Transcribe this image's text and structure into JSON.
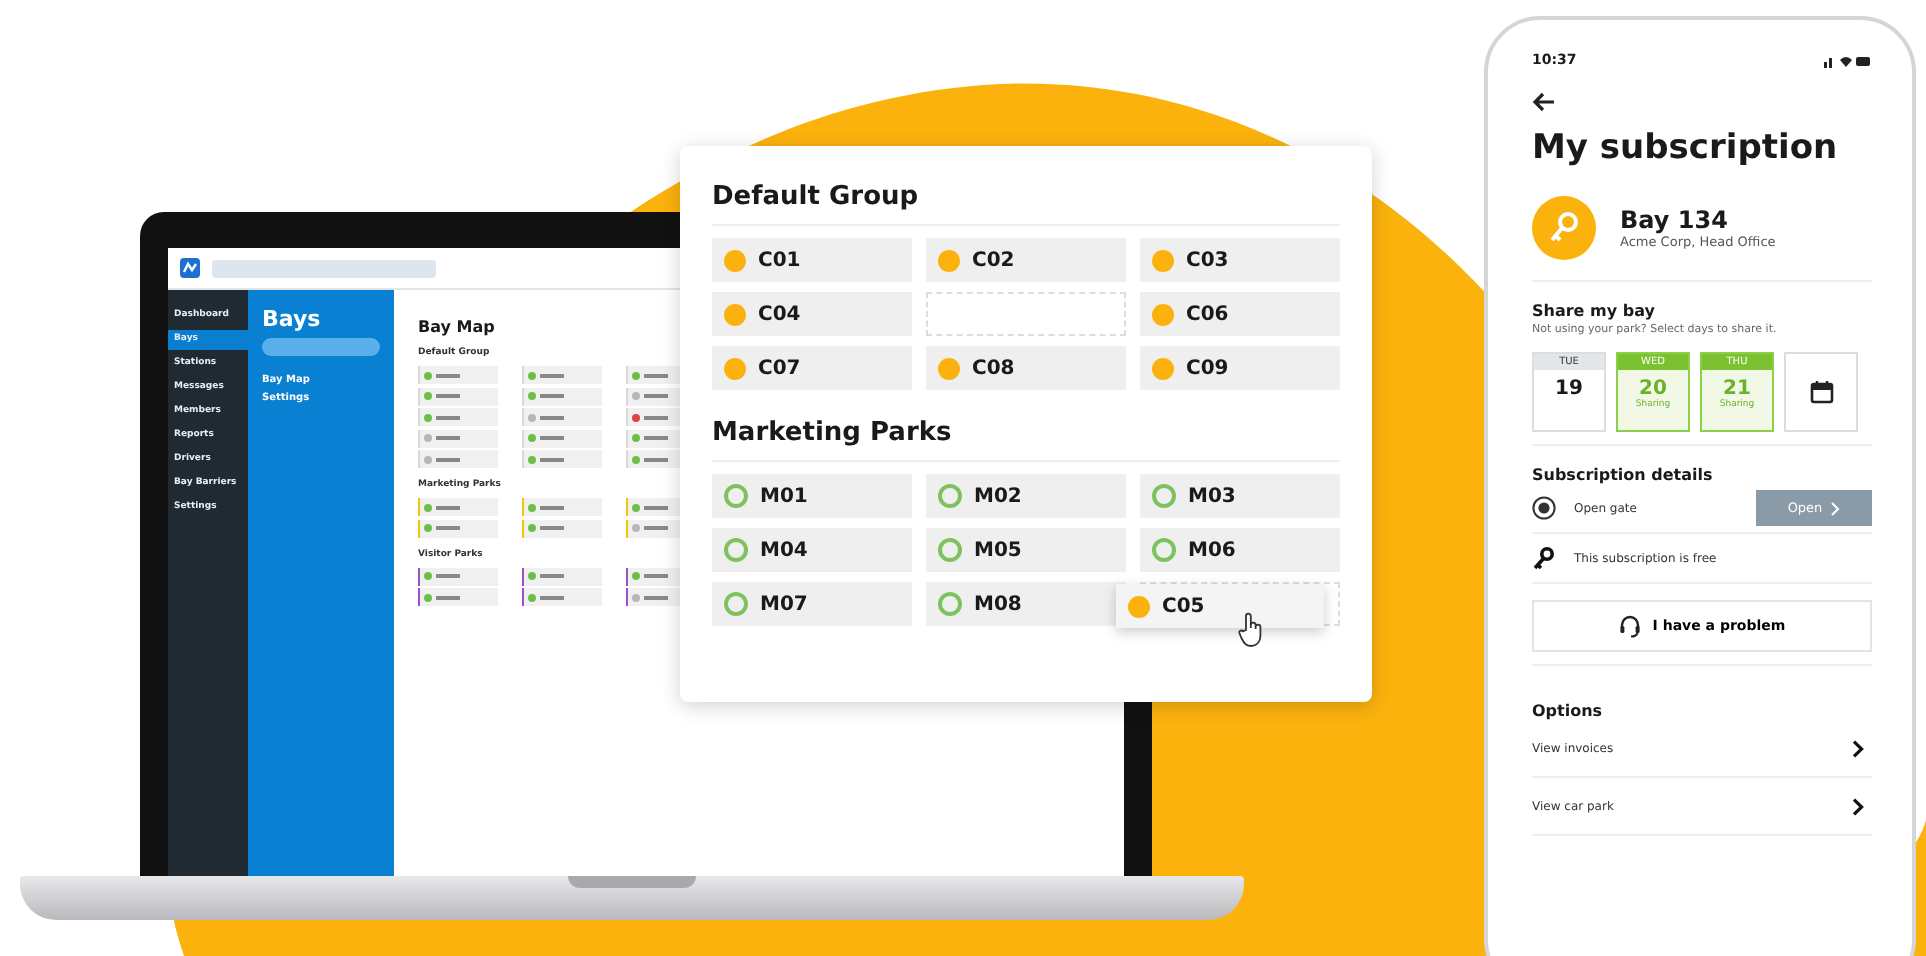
{
  "laptop": {
    "nav": [
      {
        "label": "Dashboard",
        "selected": false
      },
      {
        "label": "Bays",
        "selected": true
      },
      {
        "label": "Stations",
        "selected": false
      },
      {
        "label": "Messages",
        "selected": false
      },
      {
        "label": "Members",
        "selected": false
      },
      {
        "label": "Reports",
        "selected": false
      },
      {
        "label": "Drivers",
        "selected": false
      },
      {
        "label": "Bay Barriers",
        "selected": false
      },
      {
        "label": "Settings",
        "selected": false
      }
    ],
    "panel": {
      "title": "Bays",
      "links": [
        "Bay Map",
        "Settings"
      ]
    },
    "content": {
      "title": "Bay Map",
      "groups": [
        {
          "name": "Default Group",
          "color": "#d8d8d8",
          "bays": [
            {
              "color": "#6cc04a"
            },
            {
              "color": "#6cc04a"
            },
            {
              "color": "#6cc04a"
            },
            {
              "color": "#6cc04a"
            },
            {
              "color": "#6cc04a"
            },
            {
              "color": "#b8b8b8"
            },
            {
              "color": "#6cc04a"
            },
            {
              "color": "#b8b8b8"
            },
            {
              "color": "#e0404a"
            },
            {
              "color": "#b8b8b8"
            },
            {
              "color": "#6cc04a"
            },
            {
              "color": "#6cc04a"
            },
            {
              "color": "#b8b8b8"
            },
            {
              "color": "#6cc04a"
            },
            {
              "color": "#6cc04a"
            }
          ]
        },
        {
          "name": "Marketing Parks",
          "color": "#f5c400",
          "bays": [
            {
              "color": "#6cc04a"
            },
            {
              "color": "#6cc04a"
            },
            {
              "color": "#6cc04a"
            },
            {
              "color": "#6cc04a"
            },
            {
              "color": "#6cc04a"
            },
            {
              "color": "#b8b8b8"
            }
          ]
        },
        {
          "name": "Visitor Parks",
          "color": "#a050c8",
          "bays": [
            {
              "color": "#6cc04a"
            },
            {
              "color": "#6cc04a"
            },
            {
              "color": "#6cc04a"
            },
            {
              "color": "#6cc04a"
            },
            {
              "color": "#6cc04a"
            },
            {
              "color": "#b8b8b8"
            }
          ]
        }
      ]
    }
  },
  "popup": {
    "groups": [
      {
        "title": "Default Group",
        "bays": [
          {
            "label": "C01",
            "kind": "assigned"
          },
          {
            "label": "C02",
            "kind": "assigned"
          },
          {
            "label": "C03",
            "kind": "assigned"
          },
          {
            "label": "C04",
            "kind": "assigned"
          },
          {
            "kind": "empty"
          },
          {
            "label": "C06",
            "kind": "assigned"
          },
          {
            "label": "C07",
            "kind": "assigned"
          },
          {
            "label": "C08",
            "kind": "assigned"
          },
          {
            "label": "C09",
            "kind": "assigned"
          }
        ]
      },
      {
        "title": "Marketing Parks",
        "bays": [
          {
            "label": "M01",
            "kind": "available"
          },
          {
            "label": "M02",
            "kind": "available"
          },
          {
            "label": "M03",
            "kind": "available"
          },
          {
            "label": "M04",
            "kind": "available"
          },
          {
            "label": "M05",
            "kind": "available"
          },
          {
            "label": "M06",
            "kind": "available"
          },
          {
            "label": "M07",
            "kind": "available"
          },
          {
            "label": "M08",
            "kind": "available"
          },
          {
            "kind": "empty"
          }
        ]
      }
    ],
    "dragged": {
      "label": "C05",
      "kind": "assigned"
    }
  },
  "phone": {
    "time": "10:37",
    "title": "My subscription",
    "bay": {
      "name": "Bay 134",
      "place": "Acme Corp, Head Office"
    },
    "share": {
      "title": "Share my bay",
      "hint": "Not using your park? Select days to share it.",
      "days": [
        {
          "day": "TUE",
          "date": "19",
          "selected": false
        },
        {
          "day": "WED",
          "date": "20",
          "note": "Sharing",
          "selected": true
        },
        {
          "day": "THU",
          "date": "21",
          "note": "Sharing",
          "selected": true
        }
      ]
    },
    "details": {
      "title": "Subscription details",
      "gate_label": "Open gate",
      "gate_button": {
        "label": "Open",
        "disabled": true
      },
      "free_note": "This subscription is free",
      "problem_button": "I have a problem"
    },
    "options": {
      "title": "Options",
      "items": [
        "View invoices",
        "View car park"
      ]
    }
  }
}
